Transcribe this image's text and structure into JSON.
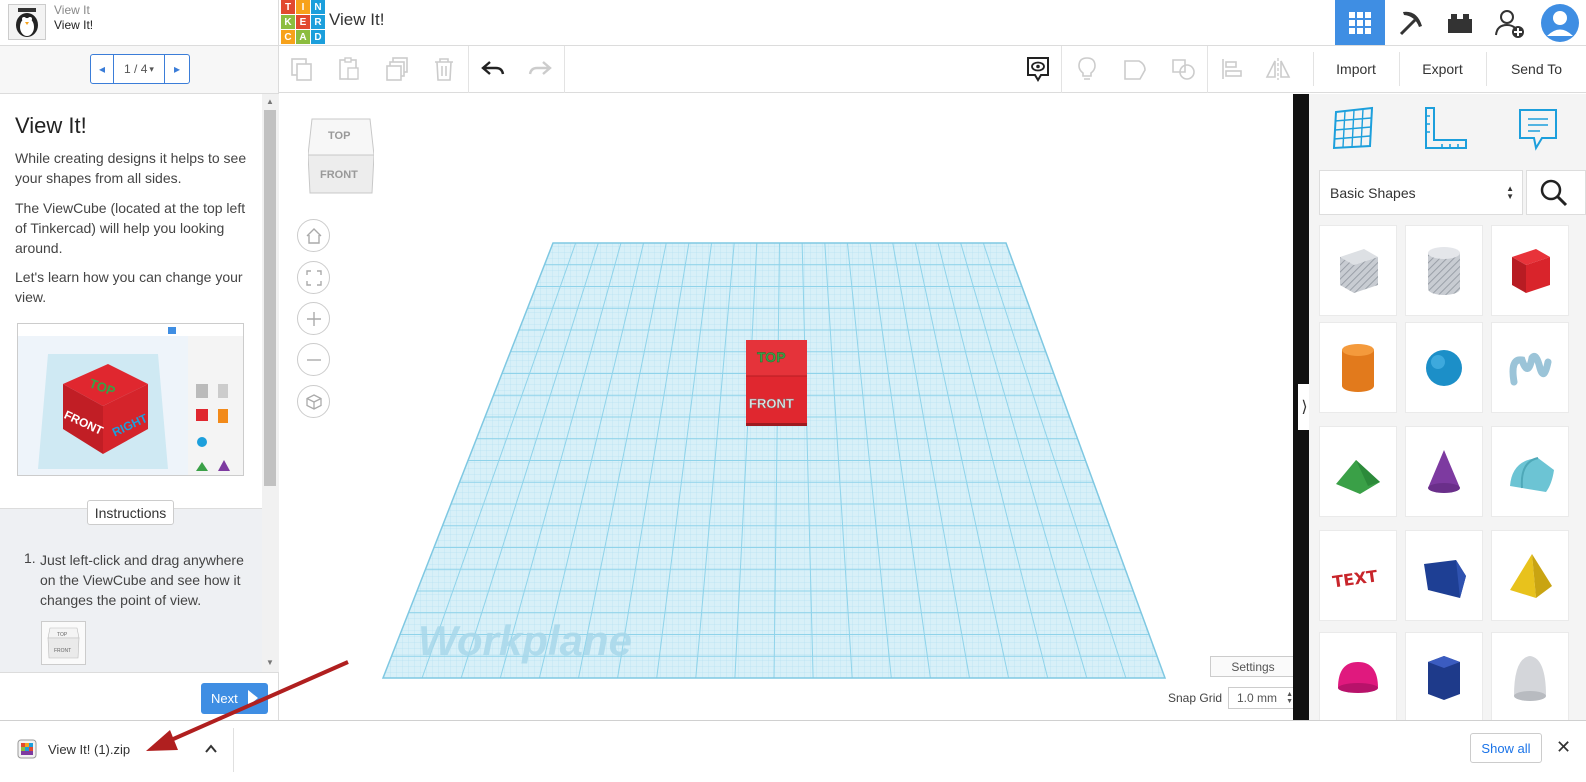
{
  "lesson": {
    "name": "View It",
    "title": "View It!",
    "pager": "1 / 4",
    "heading": "View It!",
    "paragraphs": [
      "While creating designs it helps to see your shapes from all sides.",
      "The ViewCube (located at the top left of Tinkercad) will help you looking around.",
      "Let's learn how you can change your view."
    ],
    "preview_cube_faces": [
      "TOP",
      "FRONT",
      "RIGHT"
    ],
    "instructions_label": "Instructions",
    "step_number": "1.",
    "step_text": "Just left-click and drag anywhere on the ViewCube and see how it changes the point of view.",
    "mini_cube_faces": [
      "TOP",
      "FRONT"
    ],
    "next_label": "Next"
  },
  "header": {
    "logo_letters": [
      "T",
      "I",
      "N",
      "K",
      "E",
      "R",
      "C",
      "A",
      "D"
    ],
    "logo_colors": [
      "#e2492f",
      "#f7a21b",
      "#1c9fdc",
      "#8cbd3f",
      "#e2492f",
      "#1c9fdc",
      "#f7a21b",
      "#8cbd3f",
      "#1c9fdc"
    ],
    "design_title": "View It!"
  },
  "toolbar": {
    "import_label": "Import",
    "export_label": "Export",
    "sendto_label": "Send To"
  },
  "canvas": {
    "viewcube_faces": [
      "TOP",
      "FRONT"
    ],
    "workplane_label": "Workplane",
    "box_faces": [
      "TOP",
      "FRONT"
    ],
    "settings_label": "Settings",
    "snap_grid_label": "Snap Grid",
    "snap_grid_value": "1.0 mm"
  },
  "shapes_panel": {
    "category": "Basic Shapes",
    "shapes": [
      "box-striped",
      "cylinder-striped",
      "box",
      "cylinder",
      "sphere",
      "scribble",
      "roof",
      "cone",
      "round-roof",
      "text",
      "wedge",
      "pyramid",
      "half-sphere",
      "polygon",
      "paraboloid"
    ]
  },
  "downloads": {
    "file_name": "View It! (1).zip",
    "show_all": "Show all"
  },
  "colors": {
    "accent": "#3f8ee3",
    "grid": "#8fd3ea",
    "box": "#e0272f",
    "arrow": "#b01f1f"
  }
}
